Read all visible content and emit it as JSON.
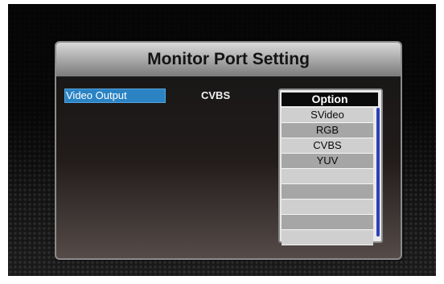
{
  "title": "Monitor Port Setting",
  "setting": {
    "label": "Video Output",
    "value": "CVBS"
  },
  "option_menu": {
    "header": "Option",
    "items": [
      "SVideo",
      "RGB",
      "CVBS",
      "YUV",
      "",
      "",
      "",
      "",
      ""
    ]
  },
  "colors": {
    "highlight": "#2b83c4",
    "scrollbar": "#2c41b8"
  }
}
